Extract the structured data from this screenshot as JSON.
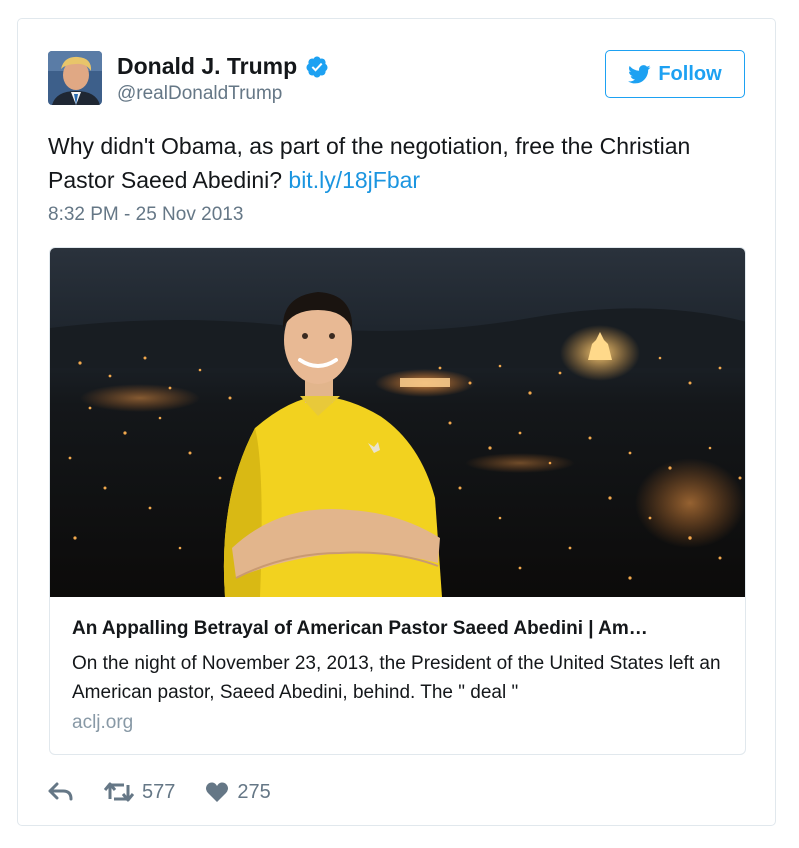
{
  "tweet": {
    "author_name": "Donald J. Trump",
    "author_handle": "@realDonaldTrump",
    "follow_label": "Follow",
    "text_main": "Why didn't Obama, as part of the negotiation, free the Christian Pastor Saeed Abedini?",
    "text_link": "bit.ly/18jFbar",
    "timestamp": "8:32 PM - 25 Nov 2013"
  },
  "card": {
    "title": "An Appalling Betrayal of American Pastor Saeed Abedini | Am…",
    "description": "On the night of November 23, 2013, the President of the United States left an American pastor, Saeed Abedini, behind. The \" deal \"",
    "domain": "aclj.org"
  },
  "actions": {
    "retweet_count": "577",
    "like_count": "275"
  },
  "icons": {
    "verified": "verified-badge-icon",
    "follow": "twitter-bird-icon",
    "reply": "reply-icon",
    "retweet": "retweet-icon",
    "like": "heart-icon"
  },
  "colors": {
    "accent": "#1da1f2",
    "link": "#1b95e0",
    "secondary_text": "#657786",
    "domain_text": "#8899a6",
    "border": "#e1e8ed"
  }
}
